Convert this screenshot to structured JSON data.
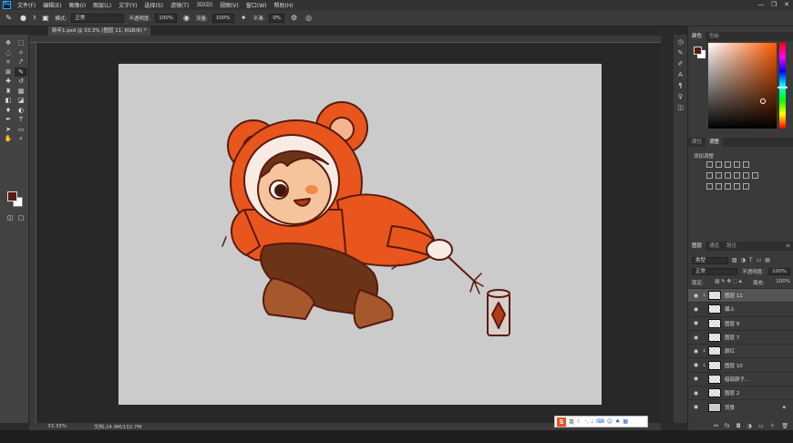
{
  "menubar": {
    "logo": "Ps",
    "items": [
      "文件(F)",
      "编辑(E)",
      "图像(I)",
      "图层(L)",
      "文字(Y)",
      "选择(S)",
      "滤镜(T)",
      "3D(D)",
      "视图(V)",
      "窗口(W)",
      "帮助(H)"
    ],
    "window_controls": [
      "—",
      "❐",
      "✕"
    ]
  },
  "options": {
    "brush_size": "3",
    "mode_label": "模式:",
    "mode_value": "正常",
    "opacity_label": "不透明度:",
    "opacity_value": "100%",
    "flow_label": "流量:",
    "flow_value": "100%",
    "smoothing_label": "平滑:",
    "smoothing_value": "0%"
  },
  "document": {
    "tab_label": "新年1.psd @ 33.3% (图层 11, RGB/8) *",
    "zoom": "33.33%",
    "doc_size": "文档:24.9M/132.7M"
  },
  "ime": {
    "lang": "英"
  },
  "panels": {
    "color_tabs": [
      "颜色",
      "色板"
    ],
    "adjust_tabs": [
      "属性",
      "调整"
    ],
    "adjust_title": "添加调整",
    "layer_tabs": [
      "图层",
      "通道",
      "路径"
    ],
    "filter_kind": "类型",
    "blend_mode": "正常",
    "opacity_label": "不透明度:",
    "opacity_value": "100%",
    "lock_label": "锁定:",
    "fill_label": "填充:",
    "fill_value": "100%"
  },
  "layers": [
    {
      "name": "图层 11",
      "clip": "↓",
      "selected": true,
      "thumb": "checker"
    },
    {
      "name": "爆上",
      "clip": "",
      "selected": false,
      "thumb": "checker"
    },
    {
      "name": "图层 9",
      "clip": "",
      "selected": false,
      "thumb": "checker"
    },
    {
      "name": "图层 7",
      "clip": "",
      "selected": false,
      "thumb": "checker"
    },
    {
      "name": "颜红",
      "clip": "↓",
      "selected": false,
      "thumb": "checker"
    },
    {
      "name": "图层 10",
      "clip": "↓",
      "selected": false,
      "thumb": "checker"
    },
    {
      "name": "暗部颜子...",
      "clip": "",
      "selected": false,
      "thumb": "checker"
    },
    {
      "name": "图层 2",
      "clip": "",
      "selected": false,
      "thumb": "checker"
    },
    {
      "name": "背景",
      "clip": "",
      "selected": false,
      "thumb": "gray",
      "locked": true
    }
  ],
  "colors": {
    "foreground": "#5a1a0c",
    "accent_orange": "#e8561e"
  }
}
